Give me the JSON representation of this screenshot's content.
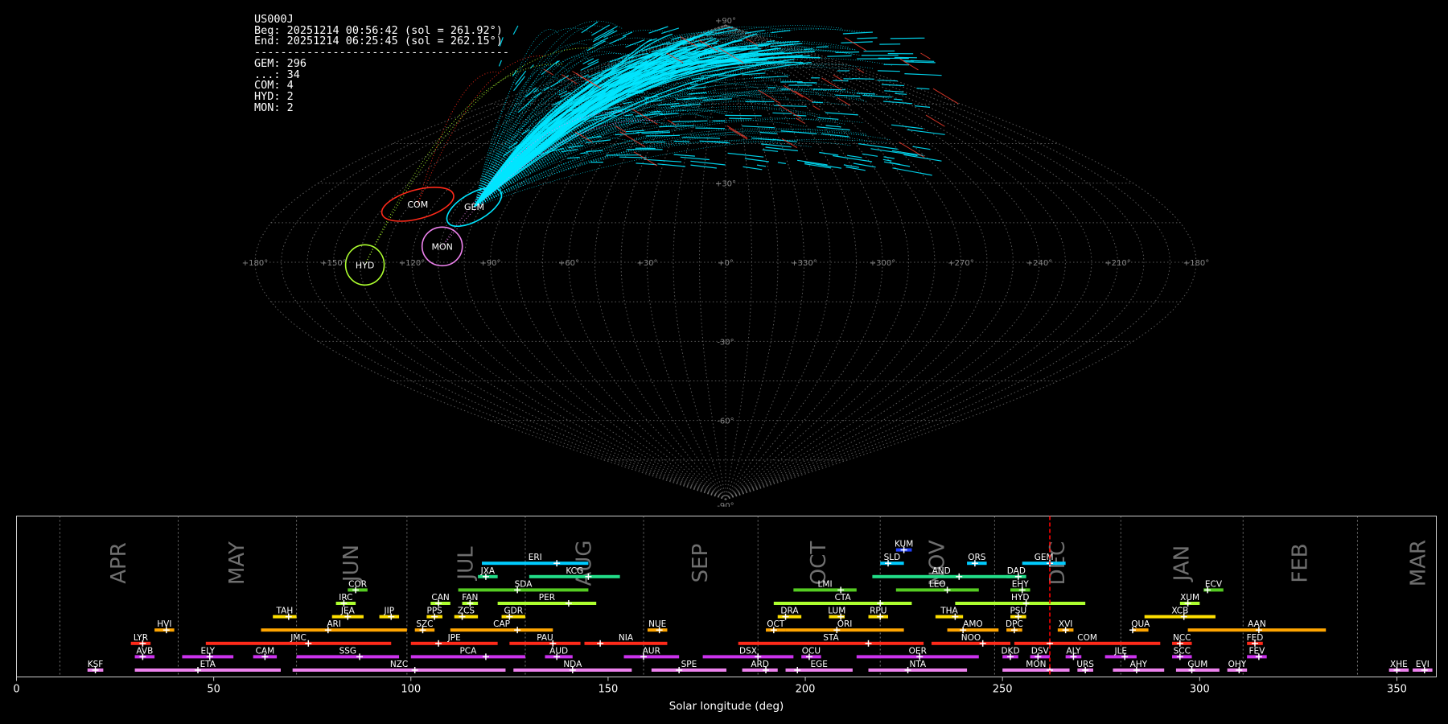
{
  "info": {
    "station": "US000J",
    "beg": "Beg: 20251214 00:56:42 (sol = 261.92°)",
    "end": "End: 20251214 06:25:45 (sol = 262.15°)",
    "separator": "---------------------------------------",
    "counts": [
      "GEM: 296",
      "...: 34",
      "COM: 4",
      "HYD: 2",
      "MON: 2"
    ]
  },
  "colors": {
    "GEM": "#00e5ff",
    "COM": "#ff2a1a",
    "HYD": "#adff2f",
    "MON": "#ee82ee",
    "grid": "#777777",
    "sol_marker": "#ff0000",
    "sporadic": "#ff4030"
  },
  "chart_data": [
    {
      "type": "scatter",
      "projection": "sinusoidal",
      "lon_ticks": [
        "+180°",
        "+150°",
        "+120°",
        "+90°",
        "+60°",
        "+30°",
        "+0°",
        "+330°",
        "+300°",
        "+270°",
        "+240°",
        "+210°",
        "+180°"
      ],
      "lat_ticks": [
        "+90°",
        "+30°",
        "-30°",
        "-60°",
        "-90°"
      ],
      "radiants": [
        {
          "name": "COM",
          "lon": 127,
          "lat": 22,
          "rx": 46,
          "ry": 18,
          "rot": -15
        },
        {
          "name": "GEM",
          "lon": 103,
          "lat": 21,
          "rx": 38,
          "ry": 17,
          "rot": -30
        },
        {
          "name": "HYD",
          "lon": 138,
          "lat": -1,
          "rx": 24,
          "ry": 25,
          "rot": 0
        },
        {
          "name": "MON",
          "lon": 109,
          "lat": 6,
          "rx": 25,
          "ry": 24,
          "rot": 0
        }
      ],
      "trail_end": {
        "lon": 0,
        "lat": 75
      },
      "sporadic_count": 34
    },
    {
      "type": "timeline",
      "xlabel": "Solar longitude (deg)",
      "xlim": [
        0,
        360
      ],
      "xticks": [
        0,
        50,
        100,
        150,
        200,
        250,
        300,
        350
      ],
      "current_sol": 262,
      "months": [
        {
          "label": "APR",
          "boundary": 11
        },
        {
          "label": "MAY",
          "boundary": 41
        },
        {
          "label": "JUN",
          "boundary": 71
        },
        {
          "label": "JUL",
          "boundary": 99
        },
        {
          "label": "AUG",
          "boundary": 129
        },
        {
          "label": "SEP",
          "boundary": 159
        },
        {
          "label": "OCT",
          "boundary": 188
        },
        {
          "label": "NOV",
          "boundary": 219
        },
        {
          "label": "DEC",
          "boundary": 248
        },
        {
          "label": "JAN",
          "boundary": 280
        },
        {
          "label": "FEB",
          "boundary": 311
        },
        {
          "label": "MAR",
          "boundary": 340
        }
      ],
      "showers": [
        {
          "code": "KSF",
          "s": 18,
          "e": 22,
          "p": 20,
          "row": 0,
          "c": "#ee82ee"
        },
        {
          "code": "ETA",
          "s": 30,
          "e": 67,
          "p": 46,
          "row": 0,
          "c": "#ee82ee"
        },
        {
          "code": "NZC",
          "s": 70,
          "e": 124,
          "p": 101,
          "row": 0,
          "c": "#ee82ee"
        },
        {
          "code": "NDA",
          "s": 126,
          "e": 156,
          "p": 141,
          "row": 0,
          "c": "#ee82ee"
        },
        {
          "code": "SPE",
          "s": 161,
          "e": 180,
          "p": 168,
          "row": 0,
          "c": "#ee82ee"
        },
        {
          "code": "ARD",
          "s": 184,
          "e": 193,
          "p": 190,
          "row": 0,
          "c": "#ee82ee"
        },
        {
          "code": "EGE",
          "s": 195,
          "e": 212,
          "p": 198,
          "row": 0,
          "c": "#ee82ee"
        },
        {
          "code": "NTA",
          "s": 216,
          "e": 241,
          "p": 226,
          "row": 0,
          "c": "#ee82ee"
        },
        {
          "code": "MON",
          "s": 250,
          "e": 267,
          "p": 262,
          "row": 0,
          "c": "#ee82ee"
        },
        {
          "code": "URS",
          "s": 269,
          "e": 273,
          "p": 271,
          "row": 0,
          "c": "#ee82ee"
        },
        {
          "code": "AHY",
          "s": 278,
          "e": 291,
          "p": 284,
          "row": 0,
          "c": "#ee82ee"
        },
        {
          "code": "GUM",
          "s": 294,
          "e": 305,
          "p": 298,
          "row": 0,
          "c": "#ee82ee"
        },
        {
          "code": "OHY",
          "s": 307,
          "e": 312,
          "p": 310,
          "row": 0,
          "c": "#ee82ee"
        },
        {
          "code": "XHE",
          "s": 348,
          "e": 353,
          "p": 350,
          "row": 0,
          "c": "#ee82ee"
        },
        {
          "code": "EVI",
          "s": 354,
          "e": 359,
          "p": 357,
          "row": 0,
          "c": "#ee82ee"
        },
        {
          "code": "AVB",
          "s": 30,
          "e": 35,
          "p": 32,
          "row": 1,
          "c": "#cc33ee"
        },
        {
          "code": "ELY",
          "s": 42,
          "e": 55,
          "p": 49,
          "row": 1,
          "c": "#cc33ee"
        },
        {
          "code": "CAM",
          "s": 60,
          "e": 66,
          "p": 63,
          "row": 1,
          "c": "#cc33ee"
        },
        {
          "code": "SSG",
          "s": 71,
          "e": 97,
          "p": 87,
          "row": 1,
          "c": "#cc33ee"
        },
        {
          "code": "PCA",
          "s": 100,
          "e": 129,
          "p": 119,
          "row": 1,
          "c": "#cc33ee"
        },
        {
          "code": "AUD",
          "s": 134,
          "e": 141,
          "p": 137,
          "row": 1,
          "c": "#cc33ee"
        },
        {
          "code": "AUR",
          "s": 154,
          "e": 168,
          "p": 159,
          "row": 1,
          "c": "#cc33ee"
        },
        {
          "code": "DSX",
          "s": 174,
          "e": 197,
          "p": 188,
          "row": 1,
          "c": "#cc33ee"
        },
        {
          "code": "OCU",
          "s": 199,
          "e": 204,
          "p": 201,
          "row": 1,
          "c": "#cc33ee"
        },
        {
          "code": "OER",
          "s": 213,
          "e": 244,
          "p": 229,
          "row": 1,
          "c": "#cc33ee"
        },
        {
          "code": "DKD",
          "s": 250,
          "e": 254,
          "p": 252,
          "row": 1,
          "c": "#cc33ee"
        },
        {
          "code": "DSV",
          "s": 257,
          "e": 262,
          "p": 259,
          "row": 1,
          "c": "#cc33ee"
        },
        {
          "code": "ALY",
          "s": 266,
          "e": 270,
          "p": 268,
          "row": 1,
          "c": "#cc33ee"
        },
        {
          "code": "JLE",
          "s": 276,
          "e": 284,
          "p": 281,
          "row": 1,
          "c": "#cc33ee"
        },
        {
          "code": "SCC",
          "s": 293,
          "e": 298,
          "p": 295,
          "row": 1,
          "c": "#cc33ee"
        },
        {
          "code": "FEV",
          "s": 312,
          "e": 317,
          "p": 315,
          "row": 1,
          "c": "#cc33ee"
        },
        {
          "code": "LYR",
          "s": 29,
          "e": 34,
          "p": 32,
          "row": 2,
          "c": "#ff2a1a"
        },
        {
          "code": "JMC",
          "s": 48,
          "e": 95,
          "p": 74,
          "row": 2,
          "c": "#ff2a1a"
        },
        {
          "code": "JPE",
          "s": 100,
          "e": 122,
          "p": 107,
          "row": 2,
          "c": "#ff2a1a"
        },
        {
          "code": "PAU",
          "s": 125,
          "e": 143,
          "p": 136,
          "row": 2,
          "c": "#ff2a1a"
        },
        {
          "code": "NIA",
          "s": 144,
          "e": 165,
          "p": 148,
          "row": 2,
          "c": "#ff2a1a"
        },
        {
          "code": "STA",
          "s": 183,
          "e": 230,
          "p": 216,
          "row": 2,
          "c": "#ff2a1a"
        },
        {
          "code": "NOO",
          "s": 232,
          "e": 252,
          "p": 245,
          "row": 2,
          "c": "#ff2a1a"
        },
        {
          "code": "COM",
          "s": 253,
          "e": 290,
          "p": 262,
          "row": 2,
          "c": "#ff2a1a"
        },
        {
          "code": "NCC",
          "s": 293,
          "e": 298,
          "p": 295,
          "row": 2,
          "c": "#ff2a1a"
        },
        {
          "code": "FED",
          "s": 312,
          "e": 316,
          "p": 314,
          "row": 2,
          "c": "#ff2a1a"
        },
        {
          "code": "HVI",
          "s": 35,
          "e": 40,
          "p": 38,
          "row": 3,
          "c": "#ffa500"
        },
        {
          "code": "ARI",
          "s": 62,
          "e": 99,
          "p": 79,
          "row": 3,
          "c": "#ffa500"
        },
        {
          "code": "SZC",
          "s": 101,
          "e": 106,
          "p": 103,
          "row": 3,
          "c": "#ffa500"
        },
        {
          "code": "CAP",
          "s": 110,
          "e": 136,
          "p": 127,
          "row": 3,
          "c": "#ffa500"
        },
        {
          "code": "NUE",
          "s": 160,
          "e": 165,
          "p": 163,
          "row": 3,
          "c": "#ffa500"
        },
        {
          "code": "OCT",
          "s": 190,
          "e": 195,
          "p": 192,
          "row": 3,
          "c": "#ffa500"
        },
        {
          "code": "ORI",
          "s": 195,
          "e": 225,
          "p": 208,
          "row": 3,
          "c": "#ffa500"
        },
        {
          "code": "AMO",
          "s": 236,
          "e": 249,
          "p": 240,
          "row": 3,
          "c": "#ffa500"
        },
        {
          "code": "DPC",
          "s": 251,
          "e": 255,
          "p": 253,
          "row": 3,
          "c": "#ffa500"
        },
        {
          "code": "XVI",
          "s": 264,
          "e": 268,
          "p": 266,
          "row": 3,
          "c": "#ffa500"
        },
        {
          "code": "QUA",
          "s": 283,
          "e": 287,
          "p": 283,
          "row": 3,
          "c": "#ffa500"
        },
        {
          "code": "AAN",
          "s": 297,
          "e": 332,
          "p": 315,
          "row": 3,
          "c": "#ffa500"
        },
        {
          "code": "TAH",
          "s": 65,
          "e": 71,
          "p": 69,
          "row": 4,
          "c": "#ffe000"
        },
        {
          "code": "JEA",
          "s": 80,
          "e": 88,
          "p": 84,
          "row": 4,
          "c": "#ffe000"
        },
        {
          "code": "JIP",
          "s": 92,
          "e": 97,
          "p": 95,
          "row": 4,
          "c": "#ffe000"
        },
        {
          "code": "PPS",
          "s": 104,
          "e": 108,
          "p": 106,
          "row": 4,
          "c": "#ffe000"
        },
        {
          "code": "ZCS",
          "s": 111,
          "e": 117,
          "p": 113,
          "row": 4,
          "c": "#ffe000"
        },
        {
          "code": "GDR",
          "s": 123,
          "e": 129,
          "p": 125,
          "row": 4,
          "c": "#ffe000"
        },
        {
          "code": "DRA",
          "s": 193,
          "e": 199,
          "p": 195,
          "row": 4,
          "c": "#ffe000"
        },
        {
          "code": "LUM",
          "s": 206,
          "e": 210,
          "p": 209,
          "row": 4,
          "c": "#ffe000"
        },
        {
          "code": "RPU",
          "s": 216,
          "e": 221,
          "p": 219,
          "row": 4,
          "c": "#ffe000"
        },
        {
          "code": "THA",
          "s": 233,
          "e": 240,
          "p": 238,
          "row": 4,
          "c": "#ffe000"
        },
        {
          "code": "PSU",
          "s": 252,
          "e": 256,
          "p": 254,
          "row": 4,
          "c": "#ffe000"
        },
        {
          "code": "XCB",
          "s": 286,
          "e": 304,
          "p": 296,
          "row": 4,
          "c": "#ffe000"
        },
        {
          "code": "IRC",
          "s": 81,
          "e": 86,
          "p": 83,
          "row": 5,
          "c": "#adff2f"
        },
        {
          "code": "CAN",
          "s": 105,
          "e": 110,
          "p": 107,
          "row": 5,
          "c": "#adff2f"
        },
        {
          "code": "FAN",
          "s": 113,
          "e": 117,
          "p": 115,
          "row": 5,
          "c": "#adff2f"
        },
        {
          "code": "PER",
          "s": 122,
          "e": 147,
          "p": 140,
          "row": 5,
          "c": "#adff2f"
        },
        {
          "code": "CTA",
          "s": 192,
          "e": 227,
          "p": 219,
          "row": 5,
          "c": "#adff2f"
        },
        {
          "code": "HYD",
          "s": 238,
          "e": 271,
          "p": 256,
          "row": 5,
          "c": "#adff2f"
        },
        {
          "code": "XUM",
          "s": 295,
          "e": 300,
          "p": 297,
          "row": 5,
          "c": "#adff2f"
        },
        {
          "code": "COR",
          "s": 84,
          "e": 89,
          "p": 86,
          "row": 6,
          "c": "#55cc22"
        },
        {
          "code": "SDA",
          "s": 112,
          "e": 145,
          "p": 127,
          "row": 6,
          "c": "#55cc22"
        },
        {
          "code": "LMI",
          "s": 197,
          "e": 213,
          "p": 209,
          "row": 6,
          "c": "#55cc22"
        },
        {
          "code": "LEO",
          "s": 223,
          "e": 244,
          "p": 236,
          "row": 6,
          "c": "#55cc22"
        },
        {
          "code": "EHY",
          "s": 252,
          "e": 257,
          "p": 255,
          "row": 6,
          "c": "#55cc22"
        },
        {
          "code": "ECV",
          "s": 301,
          "e": 306,
          "p": 302,
          "row": 6,
          "c": "#55cc22"
        },
        {
          "code": "JXA",
          "s": 117,
          "e": 122,
          "p": 119,
          "row": 7,
          "c": "#22dd88"
        },
        {
          "code": "KCG",
          "s": 130,
          "e": 153,
          "p": 145,
          "row": 7,
          "c": "#22dd88"
        },
        {
          "code": "AND",
          "s": 217,
          "e": 252,
          "p": 239,
          "row": 7,
          "c": "#22dd88"
        },
        {
          "code": "DAD",
          "s": 251,
          "e": 256,
          "p": 254,
          "row": 7,
          "c": "#22dd88"
        },
        {
          "code": "ERI",
          "s": 118,
          "e": 145,
          "p": 137,
          "row": 8,
          "c": "#00ccff"
        },
        {
          "code": "SLD",
          "s": 219,
          "e": 225,
          "p": 221,
          "row": 8,
          "c": "#00ccff"
        },
        {
          "code": "ORS",
          "s": 241,
          "e": 246,
          "p": 243,
          "row": 8,
          "c": "#00ccff"
        },
        {
          "code": "GEM",
          "s": 255,
          "e": 266,
          "p": 262,
          "row": 8,
          "c": "#00ccff"
        },
        {
          "code": "KUM",
          "s": 223,
          "e": 227,
          "p": 225,
          "row": 9,
          "c": "#2040ff"
        }
      ]
    }
  ]
}
